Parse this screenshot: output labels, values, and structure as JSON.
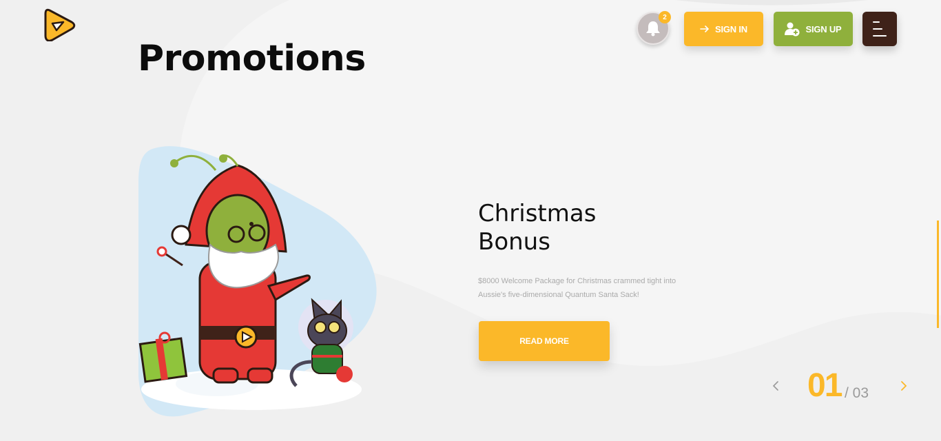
{
  "header": {
    "notification_count": "2",
    "signin_label": "SIGN IN",
    "signup_label": "SIGN UP"
  },
  "page": {
    "title": "Promotions"
  },
  "promo": {
    "title_line1": "Christmas",
    "title_line2": "Bonus",
    "description_line1": "$8000 Welcome Package for Christmas crammed tight into",
    "description_line2": "Aussie's five-dimensional Quantum Santa Sack!",
    "cta_label": "READ MORE"
  },
  "pagination": {
    "current": "01",
    "total": "/ 03"
  },
  "icons": {
    "logo": "play-rocket-logo",
    "bell": "bell-icon",
    "signin": "arrow-right-icon",
    "signup": "add-user-icon",
    "menu": "hamburger-menu-icon",
    "prev": "chevron-left-icon",
    "next": "chevron-right-icon"
  },
  "colors": {
    "accent": "#fbb829",
    "signup_green": "#8fb03c",
    "menu_brown": "#3f2219",
    "background": "#f0f0f0"
  }
}
